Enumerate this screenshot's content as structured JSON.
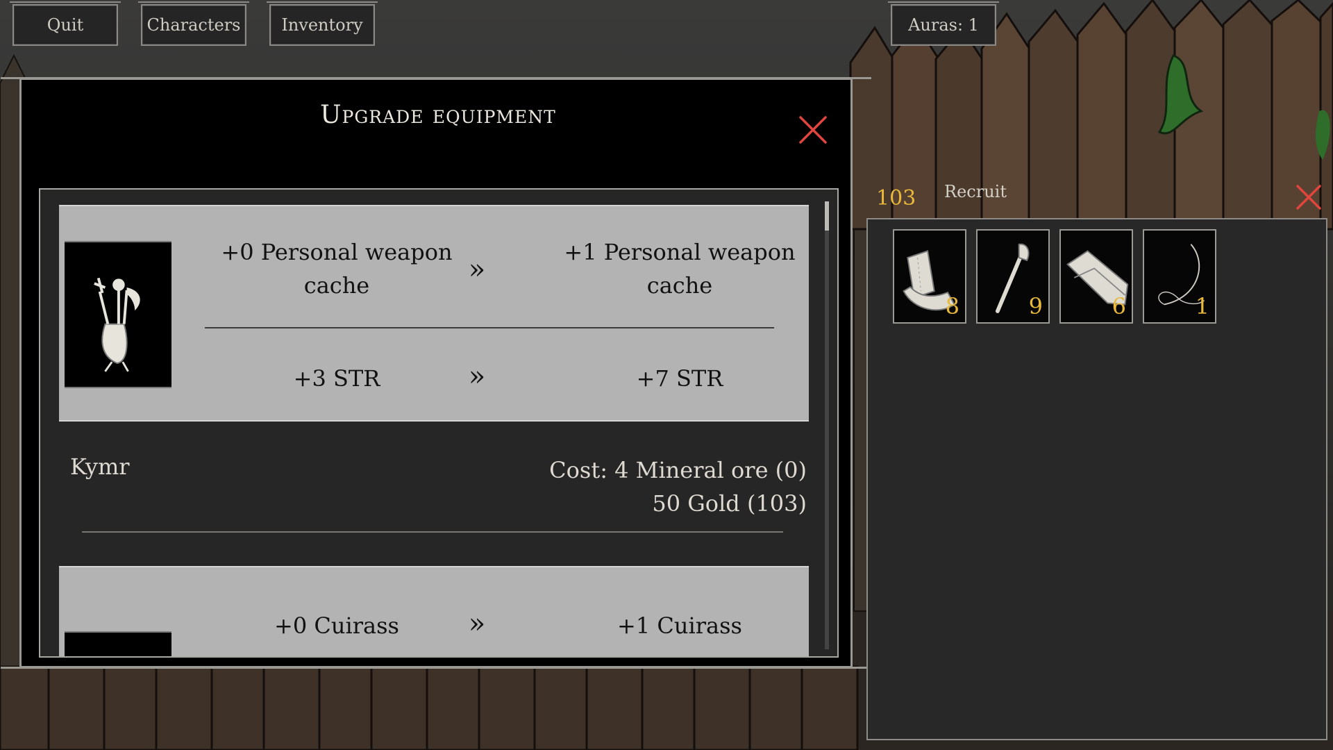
{
  "top_buttons": {
    "quit": "Quit",
    "characters": "Characters",
    "inventory": "Inventory",
    "auras": "Auras: 1"
  },
  "dialog": {
    "title": "Upgrade equipment",
    "close_icon": "close-x-icon",
    "upgrades": [
      {
        "from_name": "+0 Personal weapon cache",
        "to_name": "+1 Personal weapon cache",
        "from_stat": "+3 STR",
        "to_stat": "+7 STR",
        "arrow": "»",
        "icon": "weapon-cache-icon"
      },
      {
        "from_name": "+0 Cuirass",
        "to_name": "+1 Cuirass",
        "arrow": "»",
        "icon": "cuirass-icon"
      }
    ],
    "character": "Kymr",
    "cost_line_1": "Cost: 4 Mineral ore (0)",
    "cost_line_2": "50 Gold (103)"
  },
  "inventory": {
    "gold": "103",
    "recruit_label": "Recruit",
    "close_icon": "close-x-icon",
    "slots": [
      {
        "icon": "leather-bracers-icon",
        "count": "8"
      },
      {
        "icon": "wooden-club-icon",
        "count": "9"
      },
      {
        "icon": "leather-boots-icon",
        "count": "6"
      },
      {
        "icon": "bow-string-icon",
        "count": "1"
      }
    ]
  },
  "colors": {
    "accent_close": "#e0453e",
    "gold_text": "#e8b93a",
    "card_bg": "#b3b3b3",
    "panel_bg": "#262626"
  }
}
